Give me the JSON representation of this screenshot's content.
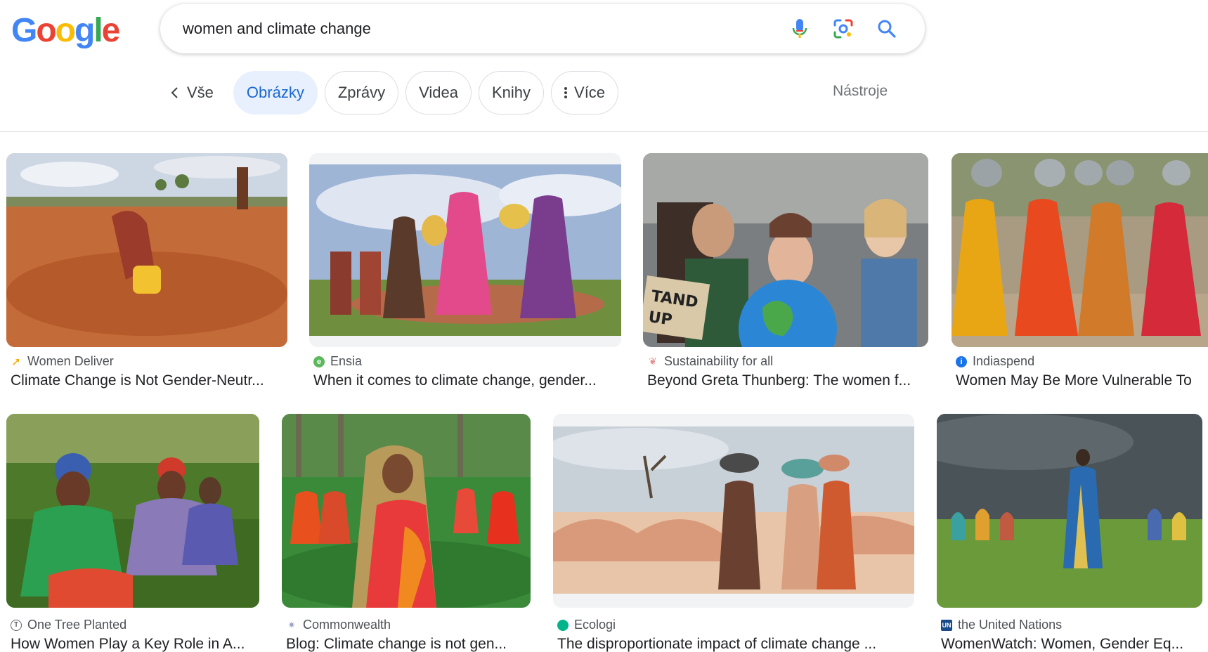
{
  "logo": {
    "letters": [
      "G",
      "o",
      "o",
      "g",
      "l",
      "e"
    ],
    "colors": [
      "#4285F4",
      "#EA4335",
      "#FBBC05",
      "#4285F4",
      "#34A853",
      "#EA4335"
    ]
  },
  "search": {
    "query": "women and climate change"
  },
  "icons": {
    "mic": "microphone-icon",
    "lens": "google-lens-icon",
    "search": "search-icon"
  },
  "nav": {
    "back": "Vše",
    "chips": [
      "Obrázky",
      "Zprávy",
      "Videa",
      "Knihy"
    ],
    "more": "Více",
    "tools": "Nástroje"
  },
  "colors": {
    "active_chip_bg": "#e8f0fe",
    "active_chip_text": "#1967d2"
  },
  "results": [
    {
      "source": "Women Deliver",
      "title": "Climate Change is Not Gender-Neutr...",
      "favicon": "arrow",
      "favicon_color": "#f2a900"
    },
    {
      "source": "Ensia",
      "title": "When it comes to climate change, gender...",
      "favicon": "e",
      "favicon_color": "#5cb85c"
    },
    {
      "source": "Sustainability for all",
      "title": "Beyond Greta Thunberg: The women f...",
      "favicon": "leaf",
      "favicon_color": "#e58f8f"
    },
    {
      "source": "Indiaspend",
      "title": "Women May Be More Vulnerable To",
      "favicon": "i",
      "favicon_color": "#1a73e8"
    },
    {
      "source": "One Tree Planted",
      "title": "How Women Play a Key Role in A...",
      "favicon": "tree",
      "favicon_color": "#5f6368"
    },
    {
      "source": "Commonwealth",
      "title": "Blog: Climate change is not gen...",
      "favicon": "star",
      "favicon_color": "#9aa0c8"
    },
    {
      "source": "Ecologi",
      "title": "The disproportionate impact of climate change ...",
      "favicon": "blob",
      "favicon_color": "#00b48b"
    },
    {
      "source": "the United Nations",
      "title": "WomenWatch: Women, Gender Eq...",
      "favicon": "UN",
      "favicon_color": "#1a4a8c"
    }
  ]
}
